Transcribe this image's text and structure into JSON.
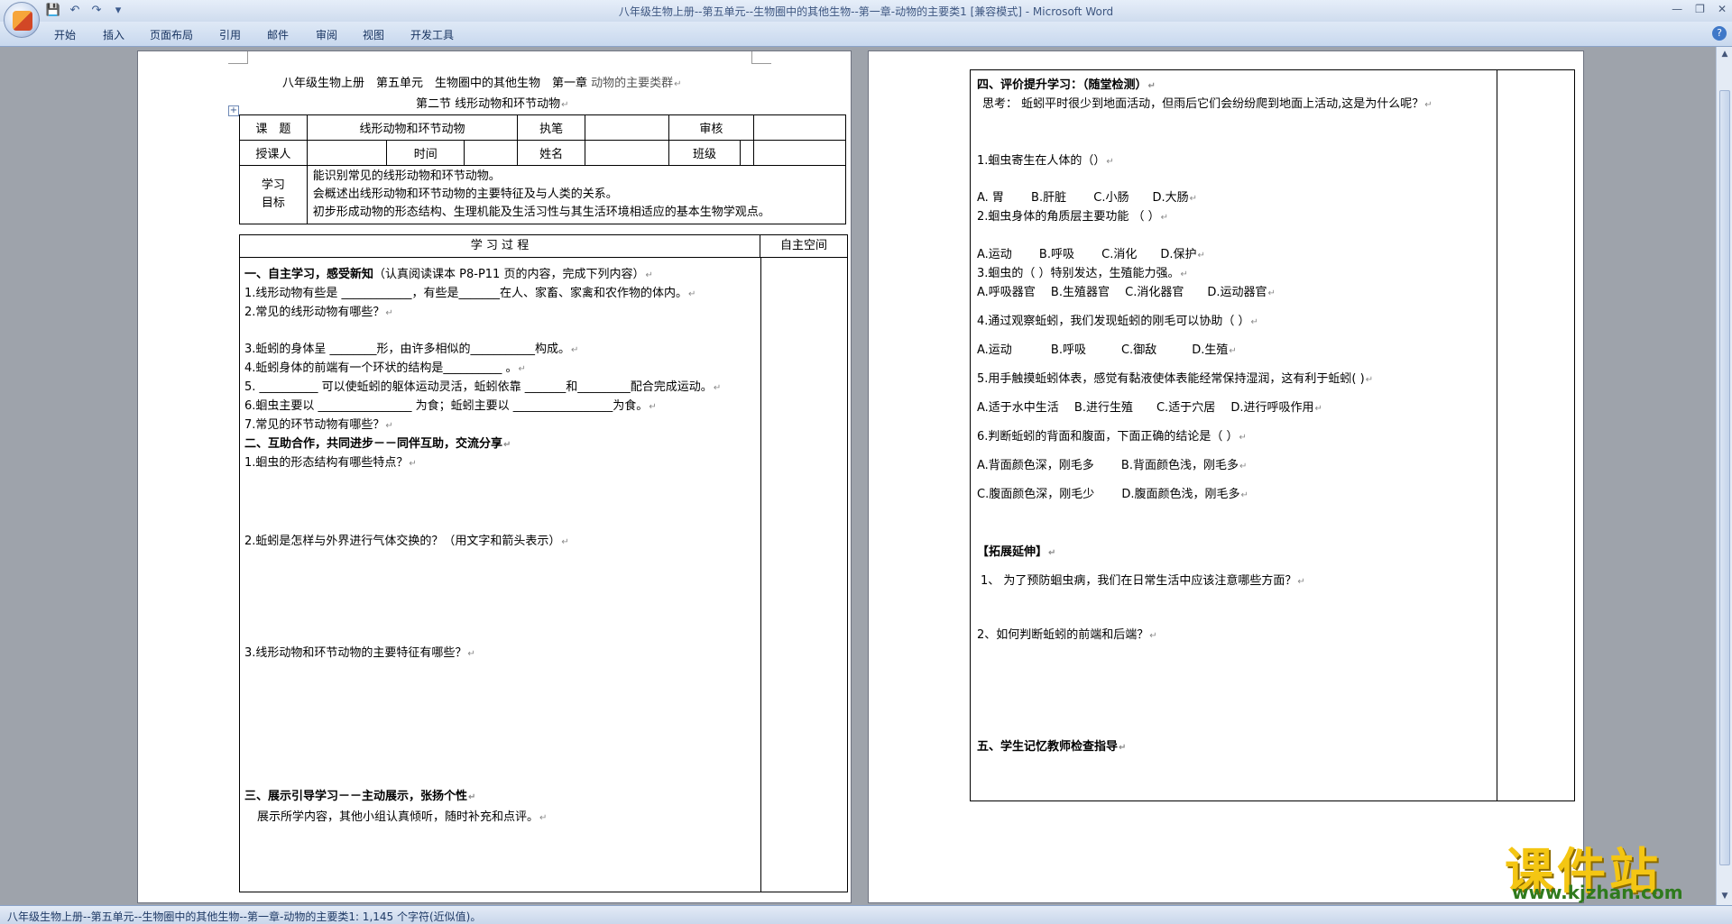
{
  "window": {
    "title": "八年级生物上册--第五单元--生物圈中的其他生物--第一章-动物的主要类1 [兼容模式] - ",
    "app_name": "Microsoft Word"
  },
  "ribbon": {
    "tabs": [
      "开始",
      "插入",
      "页面布局",
      "引用",
      "邮件",
      "审阅",
      "视图",
      "开发工具"
    ]
  },
  "page1": {
    "title": "八年级生物上册　第五单元　生物圈中的其他生物　第一章 ",
    "title_tail": "动物的主要类群",
    "subtitle": "第二节  线形动物和环节动物",
    "table": {
      "topic_label": "课　题",
      "topic_value": "线形动物和环节动物",
      "writer_label": "执笔",
      "review_label": "审核",
      "teacher_label": "授课人",
      "time_label": "时间",
      "name_label": "姓名",
      "class_label": "班级",
      "goals_label_1": "学习",
      "goals_label_2": "目标",
      "goals": [
        "能识别常见的线形动物和环节动物。",
        "会概述出线形动物和环节动物的主要特征及与人类的关系。",
        "初步形成动物的形态结构、生理机能及生活习性与其生活环境相适应的基本生物学观点。"
      ],
      "process_header": "学 习 过 程",
      "space_header": "自主空间"
    },
    "section1_title": "一、自主学习，感受新知",
    "section1_note": "（认真阅读课本 P8-P11 页的内容，完成下列内容）",
    "q1": "1.线形动物有些是 ____________，有些是_______在人、家畜、家禽和农作物的体内。",
    "q2": "2.常见的线形动物有哪些？",
    "q3": "3.蚯蚓的身体呈 ________形，由许多相似的___________构成。",
    "q4": "4.蚯蚓身体的前端有一个环状的结构是__________ 。",
    "q5": "5. __________ 可以使蚯蚓的躯体运动灵活，蚯蚓依靠 _______和_________配合完成运动。",
    "q6": "6.蛔虫主要以 ________________  为食；蚯蚓主要以 _________________为食。",
    "q7": "7.常见的环节动物有哪些？",
    "section2_title": "二、互助合作，共同进步－－同伴互助，交流分享",
    "s2q1": "1.蛔虫的形态结构有哪些特点？",
    "s2q2": "2.蚯蚓是怎样与外界进行气体交换的？（用文字和箭头表示）",
    "s2q3": "3.线形动物和环节动物的主要特征有哪些？",
    "section3_title": "三、展示引导学习－－主动展示，张扬个性",
    "section3_text": "展示所学内容，其他小组认真倾听，随时补充和点评。"
  },
  "page2": {
    "section4_title": "四、评价提升学习：（随堂检测）",
    "think": "思考：  蚯蚓平时很少到地面活动，但雨后它们会纷纷爬到地面上活动,这是为什么呢？",
    "mc": [
      {
        "q": "1.蛔虫寄生在人体的（）",
        "opts": "A. 胃　　 B.肝脏　　 C.小肠　　D.大肠"
      },
      {
        "q": "2.蛔虫身体的角质层主要功能  （      ）",
        "opts": "A.运动　　 B.呼吸　　 C.消化　　D.保护"
      },
      {
        "q": "3.蛔虫的（          ）特别发达，生殖能力强。",
        "opts": " A.呼吸器官　 B.生殖器官　 C.消化器官　　D.运动器官"
      },
      {
        "q": "4.通过观察蚯蚓，我们发现蚯蚓的刚毛可以协助（          ）",
        "opts": " A.运动　　　 B.呼吸　　　C.御敌　　　D.生殖"
      },
      {
        "q": "5.用手触摸蚯蚓体表，感觉有黏液使体表能经常保持湿润，这有利于蚯蚓(      )",
        "opts": " A.适于水中生活　 B.进行生殖　　C.适于穴居　 D.进行呼吸作用"
      },
      {
        "q": "6.判断蚯蚓的背面和腹面，下面正确的结论是（        ）",
        "opts": " A.背面颜色深，刚毛多　　 B.背面颜色浅，刚毛多"
      }
    ],
    "q6_opts2": " C.腹面颜色深，刚毛少　　 D.腹面颜色浅，刚毛多",
    "extend_title": "【拓展延伸】",
    "ext1": "1、 为了预防蛔虫病，我们在日常生活中应该注意哪些方面？",
    "ext2": "2、如何判断蚯蚓的前端和后端？",
    "section5_title": "五、学生记忆教师检查指导"
  },
  "status": {
    "text": "八年级生物上册--第五单元--生物圈中的其他生物--第一章-动物的主要类1: 1,145 个字符(近似值)。"
  },
  "watermark": {
    "main": "课件站",
    "url": "www.kjzhan.com"
  },
  "marks": {
    "pilcrow": "↵"
  }
}
